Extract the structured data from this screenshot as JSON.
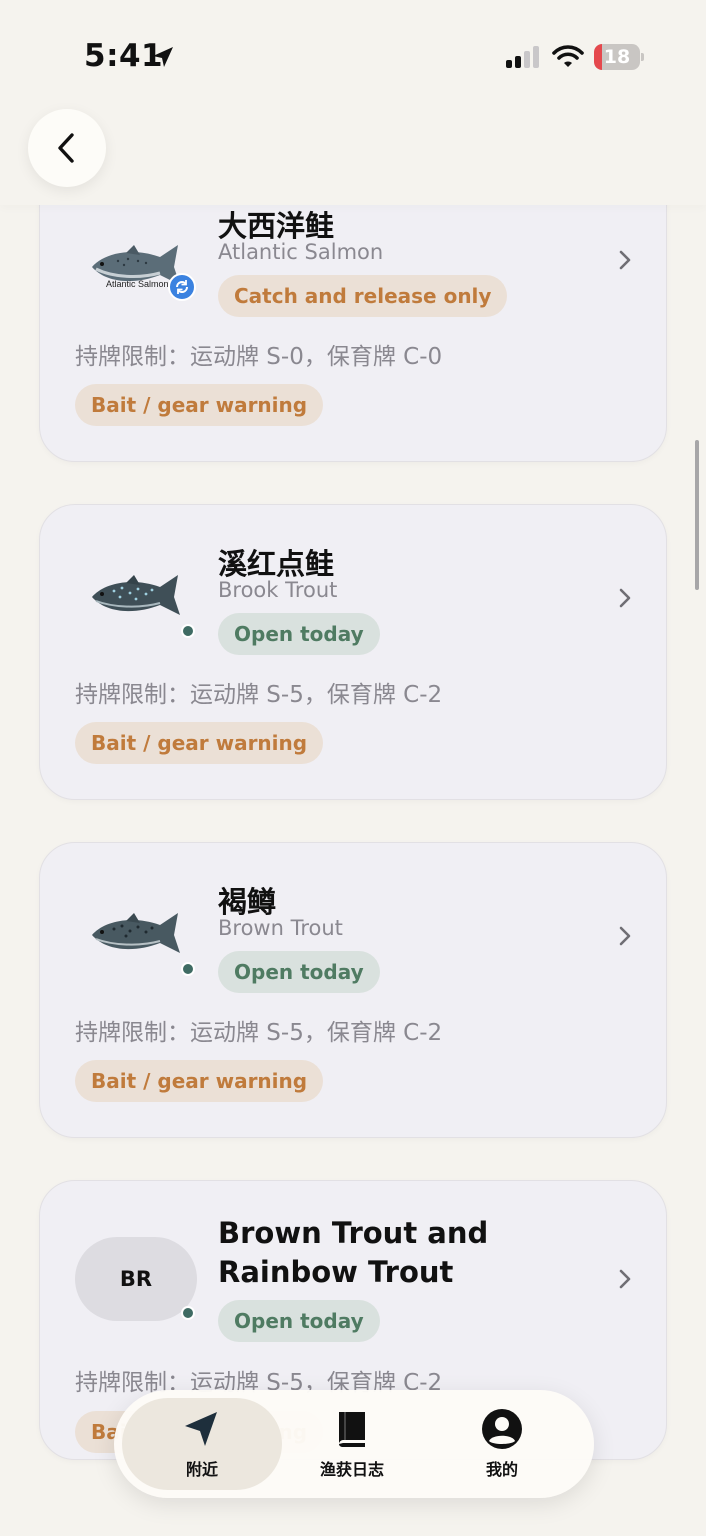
{
  "status_bar": {
    "time": "5:41",
    "battery_level": "18",
    "battery_fraction": 0.18,
    "icons": [
      "location-arrow-icon",
      "cellular-signal-icon",
      "wifi-icon",
      "battery-icon"
    ]
  },
  "header": {
    "back_icon": "chevron-left-icon"
  },
  "species": [
    {
      "name_zh": "大西洋鲑",
      "name_en": "Atlantic Salmon",
      "image_caption": "Atlantic Salmon",
      "status": "Catch and release only",
      "status_color": "#c07b3c",
      "permit": "持牌限制：运动牌 S-0，保育牌 C-0",
      "warning": "Bait / gear warning",
      "badge_icon": "sync-icon"
    },
    {
      "name_zh": "溪红点鲑",
      "name_en": "Brook Trout",
      "status": "Open today",
      "status_color": "#4f7b62",
      "permit": "持牌限制：运动牌 S-5，保育牌 C-2",
      "warning": "Bait / gear warning"
    },
    {
      "name_zh": "褐鳟",
      "name_en": "Brown Trout",
      "status": "Open today",
      "status_color": "#4f7b62",
      "permit": "持牌限制：运动牌 S-5，保育牌 C-2",
      "warning": "Bait / gear warning"
    },
    {
      "initials": "BR",
      "name": "Brown Trout and Rainbow Trout",
      "status": "Open today",
      "status_color": "#4f7b62",
      "permit": "持牌限制：运动牌 S-5，保育牌 C-2",
      "warning": "Bait / gear warning"
    }
  ],
  "tab_bar": {
    "tabs": [
      {
        "label": "附近",
        "icon": "navigation-arrow-icon",
        "active": true
      },
      {
        "label": "渔获日志",
        "icon": "book-icon",
        "active": false
      },
      {
        "label": "我的",
        "icon": "profile-icon",
        "active": false
      }
    ]
  },
  "colors": {
    "background": "#f5f3ee",
    "card": "#f0eff4",
    "open_pill_bg": "#d9e1de",
    "warning_pill_bg": "#ebe0d6",
    "status_dot": "#3f6b63",
    "battery_red": "#e5484d",
    "sync_blue": "#3b82e0"
  }
}
